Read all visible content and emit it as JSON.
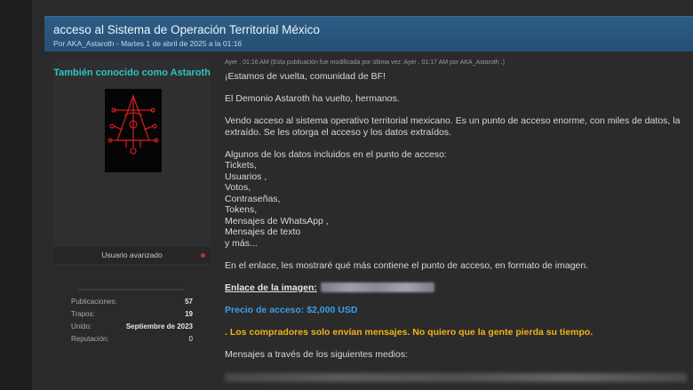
{
  "thread": {
    "title": "acceso al Sistema de Operación Territorial México",
    "meta": "Por AKA_Astaroth - Martes 1 de abril de 2025 a la 01:16"
  },
  "user": {
    "display_name": "También conocido como Astaroth",
    "avatar_icon": "sigil-avatar-icon",
    "avatar_text": "Astaroth",
    "rank": "Usuario avanzado",
    "stats": [
      {
        "label": "Publicaciones:",
        "value": "57"
      },
      {
        "label": "Trapos:",
        "value": "19"
      },
      {
        "label": "Unido:",
        "value": "Septiembre de 2023"
      },
      {
        "label": "Reputación:",
        "value": "0"
      }
    ]
  },
  "post": {
    "meta": "Ayer , 01:16 AM  (Esta publicación fue modificada por última vez: Ayer , 01:17 AM por AKA_Astaroth .)",
    "greeting": "¡Estamos de vuelta, comunidad de BF!",
    "line_return": "El Demonio Astaroth ha vuelto, hermanos.",
    "offer_1": "Vendo acceso al sistema operativo territorial mexicano. Es un punto de acceso enorme, con miles de datos, la",
    "offer_2": "extraído. Se les otorga el acceso y los datos extraídos.",
    "data_intro": "Algunos de los datos incluidos en el punto de acceso:",
    "data_items": [
      "Tickets,",
      "Usuarios ,",
      "Votos,",
      "Contraseñas,",
      "Tokens,",
      "Mensajes de WhatsApp ,",
      "Mensajes de texto",
      "y más..."
    ],
    "link_note": "En el enlace, les mostraré qué más contiene el punto de acceso, en formato de imagen.",
    "image_link_label": "Enlace de la imagen:",
    "price": "Precio de acceso: $2,000 USD",
    "warning": ". Los compradores solo envían mensajes. No quiero que la gente pierda su tiempo.",
    "contact_intro": "Mensajes a través de los siguientes medios:"
  },
  "colors": {
    "header_bg": "#2d5d86",
    "username": "#2ec4c4",
    "price": "#3d9ee8",
    "warning": "#f0b21a",
    "avatar_sigil": "#cc1c1c"
  }
}
